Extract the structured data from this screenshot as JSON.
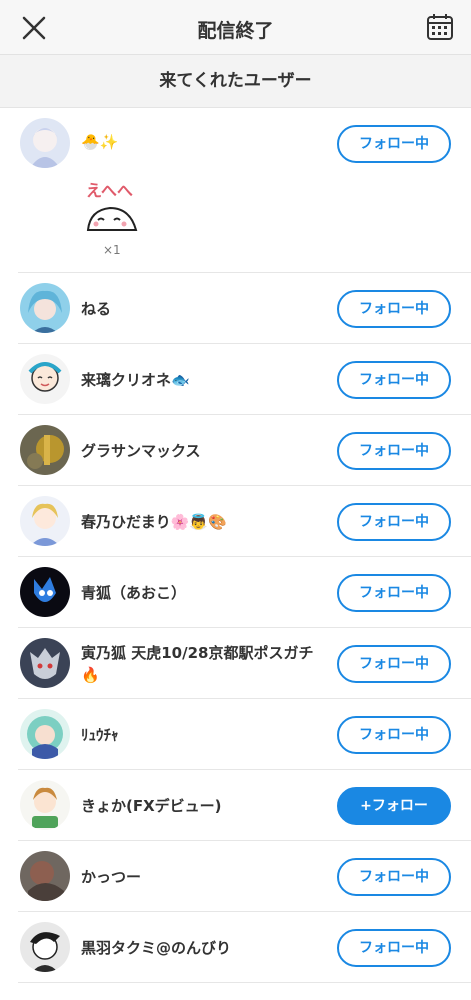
{
  "header": {
    "title": "配信終了",
    "close_icon": "close-icon",
    "calendar_icon": "calendar-icon"
  },
  "section": {
    "title": "来てくれたユーザー"
  },
  "first_user": {
    "name": "🐣✨",
    "button": "フォロー中",
    "gift_count": "×1",
    "gift_text": "えへへ"
  },
  "users": [
    {
      "name": "ねる",
      "button": "フォロー中"
    },
    {
      "name": "来璃クリオネ🐟",
      "button": "フォロー中"
    },
    {
      "name": "グラサンマックス",
      "button": "フォロー中"
    },
    {
      "name": "春乃ひだまり🌸👼🎨",
      "button": "フォロー中"
    },
    {
      "name": "青狐（あおこ）",
      "button": "フォロー中"
    },
    {
      "name": "寅乃狐 天虎10/28京都駅ポスガチ🔥",
      "button": "フォロー中"
    },
    {
      "name": "ﾘｭｳﾁｬ",
      "button": "フォロー中"
    },
    {
      "name": "きょか(FXデビュー)",
      "button": "+フォロー"
    },
    {
      "name": "かっつー",
      "button": "フォロー中"
    },
    {
      "name": "黒羽タクミ@のんびり",
      "button": "フォロー中"
    }
  ],
  "colors": {
    "accent": "#1a88e3"
  }
}
